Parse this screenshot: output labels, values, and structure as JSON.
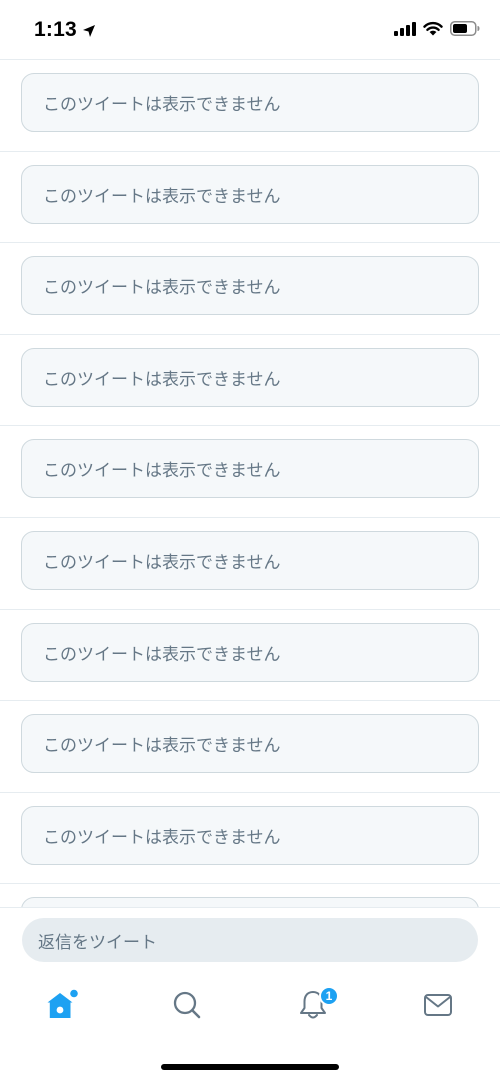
{
  "status_bar": {
    "time": "1:13",
    "icons": [
      "location-arrow-icon",
      "cellular-signal-icon",
      "wifi-icon",
      "battery-icon"
    ]
  },
  "feed": {
    "items": [
      {
        "message": "このツイートは表示できません"
      },
      {
        "message": "このツイートは表示できません"
      },
      {
        "message": "このツイートは表示できません"
      },
      {
        "message": "このツイートは表示できません"
      },
      {
        "message": "このツイートは表示できません"
      },
      {
        "message": "このツイートは表示できません"
      },
      {
        "message": "このツイートは表示できません"
      },
      {
        "message": "このツイートは表示できません"
      },
      {
        "message": "このツイートは表示できません"
      },
      {
        "message": ""
      }
    ]
  },
  "reply": {
    "placeholder": "返信をツイート"
  },
  "tab_bar": {
    "tabs": [
      {
        "name": "home",
        "icon": "home-icon",
        "active": true
      },
      {
        "name": "search",
        "icon": "search-icon"
      },
      {
        "name": "notifications",
        "icon": "bell-icon",
        "badge": "1"
      },
      {
        "name": "messages",
        "icon": "envelope-icon"
      }
    ]
  },
  "colors": {
    "accent": "#1da1f2",
    "muted_text": "#657786",
    "card_background": "#f5f8fa",
    "divider": "#e6ecf0"
  }
}
